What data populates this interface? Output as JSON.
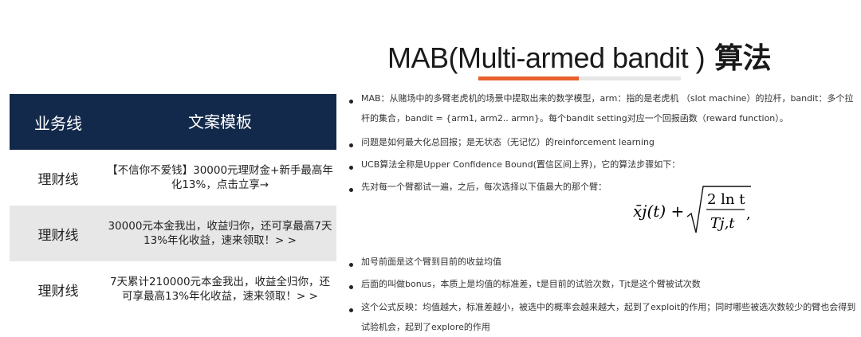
{
  "title": {
    "main": "MAB(Multi-armed bandit )",
    "suffix": " 算法"
  },
  "colors": {
    "header_bg": "#13294b",
    "accent": "#e8612c"
  },
  "table": {
    "headers": [
      "业务线",
      "文案模板"
    ],
    "rows": [
      {
        "line": "理财线",
        "text": "【不信你不爱钱】30000元理财金+新手最高年化13%，点击立享→"
      },
      {
        "line": "理财线",
        "text": "30000元本金我出，收益归你，还可享最高7天13%年化收益，速来领取！> >"
      },
      {
        "line": "理财线",
        "text": "7天累计210000元本金我出，收益全归你，还可享最高13%年化收益，速来领取！> >"
      }
    ]
  },
  "bullets": [
    "MAB：从赌场中的多臂老虎机的场景中提取出来的数学模型，arm：指的是老虎机 （slot machine）的拉杆，bandit：多个拉杆的集合，bandit = {arm1, arm2.. armn}。每个bandit setting对应一个回报函数（reward function）。",
    "问题是如何最大化总回报；是无状态（无记忆）的reinforcement learning",
    "UCB算法全称是Upper Confidence Bound(置信区间上界)，它的算法步骤如下：",
    "先对每一个臂都试一遍，之后，每次选择以下值最大的那个臂：",
    "加号前面是这个臂到目前的收益均值",
    "后面的叫做bonus，本质上是均值的标准差，t是目前的试验次数，Tjt是这个臂被试次数",
    "这个公式反映：均值越大，标准差越小，被选中的概率会越来越大，起到了exploit的作用；同时哪些被选次数较少的臂也会得到试验机会，起到了explore的作用"
  ],
  "formula": {
    "term": "x̄j(t) +",
    "numerator": "2 ln t",
    "denominator": "Tj,t",
    "trail": ","
  }
}
